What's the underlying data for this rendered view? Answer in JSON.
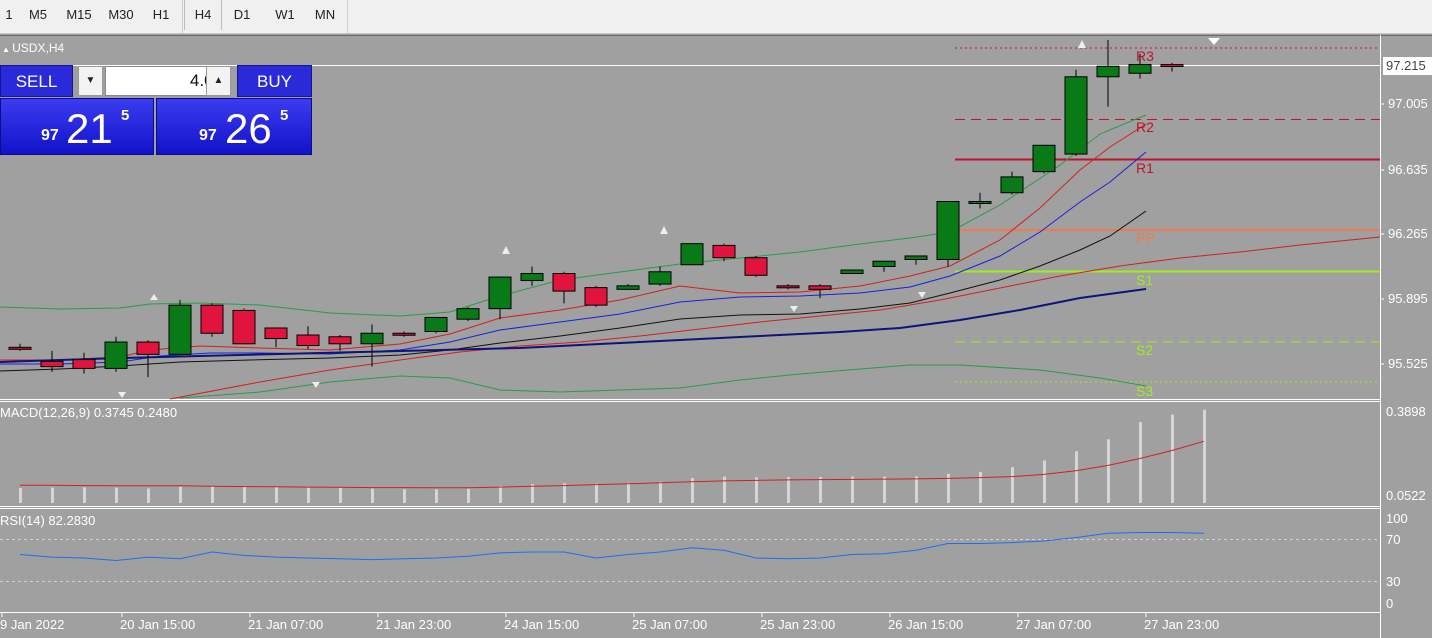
{
  "toolbar": {
    "timeframes": [
      {
        "label": "1",
        "active": false
      },
      {
        "label": "M5",
        "active": false
      },
      {
        "label": "M15",
        "active": false
      },
      {
        "label": "M30",
        "active": false
      },
      {
        "label": "H1",
        "active": false
      },
      {
        "label": "H4",
        "active": true
      },
      {
        "label": "D1",
        "active": false
      },
      {
        "label": "W1",
        "active": false
      },
      {
        "label": "MN",
        "active": false
      }
    ]
  },
  "chart": {
    "symbol_title": "USDX,H4",
    "current_price": "97.215",
    "price_axis": [
      "97.005",
      "96.635",
      "96.265",
      "95.895",
      "95.525"
    ],
    "time_axis": [
      "9 Jan 2022",
      "20 Jan 15:00",
      "21 Jan 07:00",
      "21 Jan 23:00",
      "24 Jan 15:00",
      "25 Jan 07:00",
      "25 Jan 23:00",
      "26 Jan 15:00",
      "27 Jan 07:00",
      "27 Jan 23:00"
    ],
    "pivots": [
      {
        "label": "R3",
        "color": "#c0142a"
      },
      {
        "label": "R2",
        "color": "#c0142a"
      },
      {
        "label": "R1",
        "color": "#c0142a"
      },
      {
        "label": "PP",
        "color": "#f07a50"
      },
      {
        "label": "S1",
        "color": "#9cf01a"
      },
      {
        "label": "S2",
        "color": "#9cf01a"
      },
      {
        "label": "S3",
        "color": "#9cf01a"
      }
    ],
    "candles": [
      {
        "o": 95.62,
        "h": 95.64,
        "l": 95.6,
        "c": 95.61
      },
      {
        "o": 95.54,
        "h": 95.6,
        "l": 95.48,
        "c": 95.51
      },
      {
        "o": 95.55,
        "h": 95.59,
        "l": 95.47,
        "c": 95.5
      },
      {
        "o": 95.5,
        "h": 95.68,
        "l": 95.48,
        "c": 95.65
      },
      {
        "o": 95.65,
        "h": 95.66,
        "l": 95.45,
        "c": 95.58
      },
      {
        "o": 95.58,
        "h": 95.89,
        "l": 95.58,
        "c": 95.86
      },
      {
        "o": 95.86,
        "h": 95.87,
        "l": 95.68,
        "c": 95.7
      },
      {
        "o": 95.83,
        "h": 95.84,
        "l": 95.64,
        "c": 95.64
      },
      {
        "o": 95.73,
        "h": 95.73,
        "l": 95.62,
        "c": 95.67
      },
      {
        "o": 95.69,
        "h": 95.74,
        "l": 95.61,
        "c": 95.63
      },
      {
        "o": 95.68,
        "h": 95.69,
        "l": 95.6,
        "c": 95.64
      },
      {
        "o": 95.64,
        "h": 95.75,
        "l": 95.51,
        "c": 95.7
      },
      {
        "o": 95.7,
        "h": 95.71,
        "l": 95.68,
        "c": 95.69
      },
      {
        "o": 95.71,
        "h": 95.79,
        "l": 95.7,
        "c": 95.79
      },
      {
        "o": 95.78,
        "h": 95.85,
        "l": 95.77,
        "c": 95.84
      },
      {
        "o": 95.84,
        "h": 96.02,
        "l": 95.78,
        "c": 96.02
      },
      {
        "o": 96.0,
        "h": 96.08,
        "l": 95.97,
        "c": 96.04
      },
      {
        "o": 96.04,
        "h": 96.05,
        "l": 95.87,
        "c": 95.94
      },
      {
        "o": 95.96,
        "h": 95.97,
        "l": 95.85,
        "c": 95.86
      },
      {
        "o": 95.95,
        "h": 95.98,
        "l": 95.95,
        "c": 95.97
      },
      {
        "o": 95.98,
        "h": 96.08,
        "l": 95.97,
        "c": 96.05
      },
      {
        "o": 96.09,
        "h": 96.21,
        "l": 96.09,
        "c": 96.21
      },
      {
        "o": 96.2,
        "h": 96.21,
        "l": 96.11,
        "c": 96.13
      },
      {
        "o": 96.13,
        "h": 96.14,
        "l": 96.02,
        "c": 96.03
      },
      {
        "o": 95.97,
        "h": 95.98,
        "l": 95.95,
        "c": 95.96
      },
      {
        "o": 95.97,
        "h": 95.98,
        "l": 95.9,
        "c": 95.95
      },
      {
        "o": 96.04,
        "h": 96.06,
        "l": 96.04,
        "c": 96.06
      },
      {
        "o": 96.08,
        "h": 96.11,
        "l": 96.05,
        "c": 96.11
      },
      {
        "o": 96.12,
        "h": 96.13,
        "l": 96.09,
        "c": 96.14
      },
      {
        "o": 96.12,
        "h": 96.25,
        "l": 96.08,
        "c": 96.45
      },
      {
        "o": 96.44,
        "h": 96.5,
        "l": 96.41,
        "c": 96.45
      },
      {
        "o": 96.5,
        "h": 96.62,
        "l": 96.49,
        "c": 96.59
      },
      {
        "o": 96.62,
        "h": 96.73,
        "l": 96.61,
        "c": 96.77
      },
      {
        "o": 96.72,
        "h": 97.2,
        "l": 96.71,
        "c": 97.16
      },
      {
        "o": 97.16,
        "h": 97.37,
        "l": 96.99,
        "c": 97.22
      },
      {
        "o": 97.18,
        "h": 97.29,
        "l": 97.15,
        "c": 97.23
      },
      {
        "o": 97.23,
        "h": 97.24,
        "l": 97.19,
        "c": 97.22
      }
    ],
    "macd": {
      "label": "MACD(12,26,9) 0.3745 0.2480",
      "axis_top": "0.3898",
      "axis_bottom": "0.0522",
      "histogram": [
        0.06,
        0.062,
        0.063,
        0.062,
        0.058,
        0.065,
        0.066,
        0.066,
        0.064,
        0.062,
        0.06,
        0.058,
        0.055,
        0.055,
        0.057,
        0.068,
        0.076,
        0.079,
        0.078,
        0.081,
        0.086,
        0.1,
        0.106,
        0.103,
        0.104,
        0.104,
        0.106,
        0.106,
        0.107,
        0.117,
        0.125,
        0.144,
        0.171,
        0.208,
        0.256,
        0.325,
        0.355,
        0.375
      ],
      "signal": [
        0.071,
        0.071,
        0.07,
        0.069,
        0.069,
        0.069,
        0.067,
        0.066,
        0.065,
        0.064,
        0.063,
        0.062,
        0.062,
        0.061,
        0.061,
        0.064,
        0.067,
        0.07,
        0.074,
        0.077,
        0.081,
        0.085,
        0.089,
        0.091,
        0.093,
        0.094,
        0.095,
        0.096,
        0.097,
        0.099,
        0.102,
        0.106,
        0.115,
        0.13,
        0.151,
        0.179,
        0.211,
        0.248
      ]
    },
    "rsi": {
      "label": "RSI(14) 82.2830",
      "axis": [
        "100",
        "70",
        "30",
        "0"
      ],
      "values": [
        57,
        54,
        53,
        50,
        54,
        52,
        60,
        56,
        54,
        53,
        52,
        51,
        52,
        53,
        55,
        59,
        60,
        60,
        53,
        57,
        60,
        65,
        62,
        53,
        52,
        53,
        57,
        58,
        62,
        70,
        70,
        71,
        73,
        77,
        82,
        83,
        83,
        82
      ]
    }
  }
}
